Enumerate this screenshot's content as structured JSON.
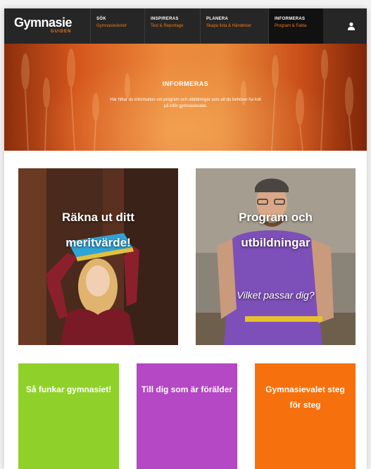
{
  "logo": {
    "main": "Gymnasie",
    "sub": "GUIDEN"
  },
  "nav": [
    {
      "title": "SÖK",
      "sub": "Gymnasieskolor"
    },
    {
      "title": "INSPIRERAS",
      "sub": "Test & Reportage"
    },
    {
      "title": "PLANERA",
      "sub": "Skapa lista & Händelser"
    },
    {
      "title": "INFORMERAS",
      "sub": "Program & Fakta"
    }
  ],
  "hero": {
    "title": "INFORMERAS",
    "desc": "Här hittar du information om program och utbildningar som att du behöver ha koll på inför gymnasievalet."
  },
  "cards": [
    {
      "title_line1": "Räkna ut ditt",
      "title_line2": "meritvärde!"
    },
    {
      "title_line1": "Program och",
      "title_line2": "utbildningar",
      "subtitle": "Vilket passar dig?"
    }
  ],
  "tiles": [
    {
      "label": "Så funkar gymnasiet!",
      "color": "#8fd12a"
    },
    {
      "label": "Till dig som är förälder",
      "color": "#b548c4"
    },
    {
      "label": "Gymnasievalet steg för steg",
      "color": "#f6700d"
    }
  ],
  "colors": {
    "nav_bg": "#262626",
    "accent": "#f07a17"
  },
  "icons": {
    "user": "user-icon"
  }
}
